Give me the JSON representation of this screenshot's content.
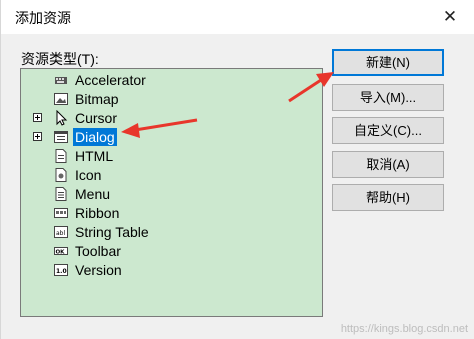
{
  "window": {
    "title": "添加资源"
  },
  "resource_list": {
    "label": "资源类型(T):",
    "items": [
      {
        "label": "Accelerator",
        "icon": "accelerator-icon",
        "expandable": false
      },
      {
        "label": "Bitmap",
        "icon": "bitmap-icon",
        "expandable": false
      },
      {
        "label": "Cursor",
        "icon": "cursor-icon",
        "expandable": true
      },
      {
        "label": "Dialog",
        "icon": "dialog-icon",
        "expandable": true,
        "selected": true
      },
      {
        "label": "HTML",
        "icon": "html-icon",
        "expandable": false
      },
      {
        "label": "Icon",
        "icon": "icon-resource-icon",
        "expandable": false
      },
      {
        "label": "Menu",
        "icon": "menu-icon",
        "expandable": false
      },
      {
        "label": "Ribbon",
        "icon": "ribbon-icon",
        "expandable": false
      },
      {
        "label": "String Table",
        "icon": "string-table-icon",
        "expandable": false
      },
      {
        "label": "Toolbar",
        "icon": "toolbar-icon",
        "expandable": false
      },
      {
        "label": "Version",
        "icon": "version-icon",
        "expandable": false
      }
    ]
  },
  "buttons": {
    "new": "新建(N)",
    "import": "导入(M)...",
    "custom": "自定义(C)...",
    "cancel": "取消(A)",
    "help": "帮助(H)"
  },
  "watermark": "https://kings.blog.csdn.net",
  "colors": {
    "list_background": "#cce8cf",
    "selection": "#0078d7",
    "annotation_arrow": "#e8362b"
  }
}
